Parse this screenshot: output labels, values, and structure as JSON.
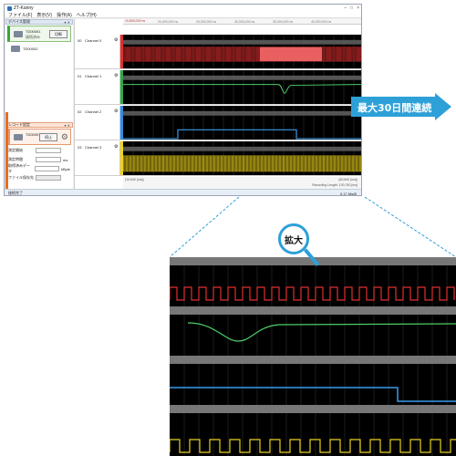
{
  "window": {
    "title": "ZT-Kanny",
    "menu": [
      "ファイル(F)",
      "表示(V)",
      "操作(A)",
      "ヘルプ(H)"
    ]
  },
  "sidebar": {
    "device_panel_title": "デバイス管理",
    "device1": {
      "name": "TD00001",
      "status": "接続済み",
      "button": "切断"
    },
    "device2": {
      "name": "TD00002"
    },
    "record_panel_title": "レコード設定",
    "record_device": {
      "name": "TD00001",
      "button": "停止"
    },
    "form": [
      {
        "label": "測定開始",
        "unit": ""
      },
      {
        "label": "測定時間",
        "unit": "ms"
      },
      {
        "label": "取得済みデータ",
        "unit": "kByte"
      },
      {
        "label": "ファイル保存先",
        "unit": ""
      }
    ]
  },
  "main": {
    "time_ticks": [
      "10,840,000 ns",
      "20,000,000 ns",
      "25,000,000 ns",
      "30,000,000 ns",
      "35,000,000 ns",
      "40,000,000 ns"
    ],
    "channels": [
      {
        "num": "00",
        "name": "Channel 0",
        "color": "#e03030"
      },
      {
        "num": "01",
        "name": "Channel 1",
        "color": "#2ea84a"
      },
      {
        "num": "02",
        "name": "Channel 2",
        "color": "#2d8fe0"
      },
      {
        "num": "03",
        "name": "Channel 3",
        "color": "#f0d21a"
      }
    ],
    "footer_left": "(10,840 [ms])",
    "footer_right": "(60,840 [ms])",
    "footer_sub": "Recording Length: 100,760 [ms]"
  },
  "statusbar": {
    "left": "接続完了",
    "right": "0.17 Ms/B"
  },
  "banner": {
    "text": "最大30日間連続"
  },
  "zoom": {
    "label": "拡大"
  },
  "colors": {
    "accent_blue": "#2da0d8",
    "orange": "#ef6a1f"
  }
}
